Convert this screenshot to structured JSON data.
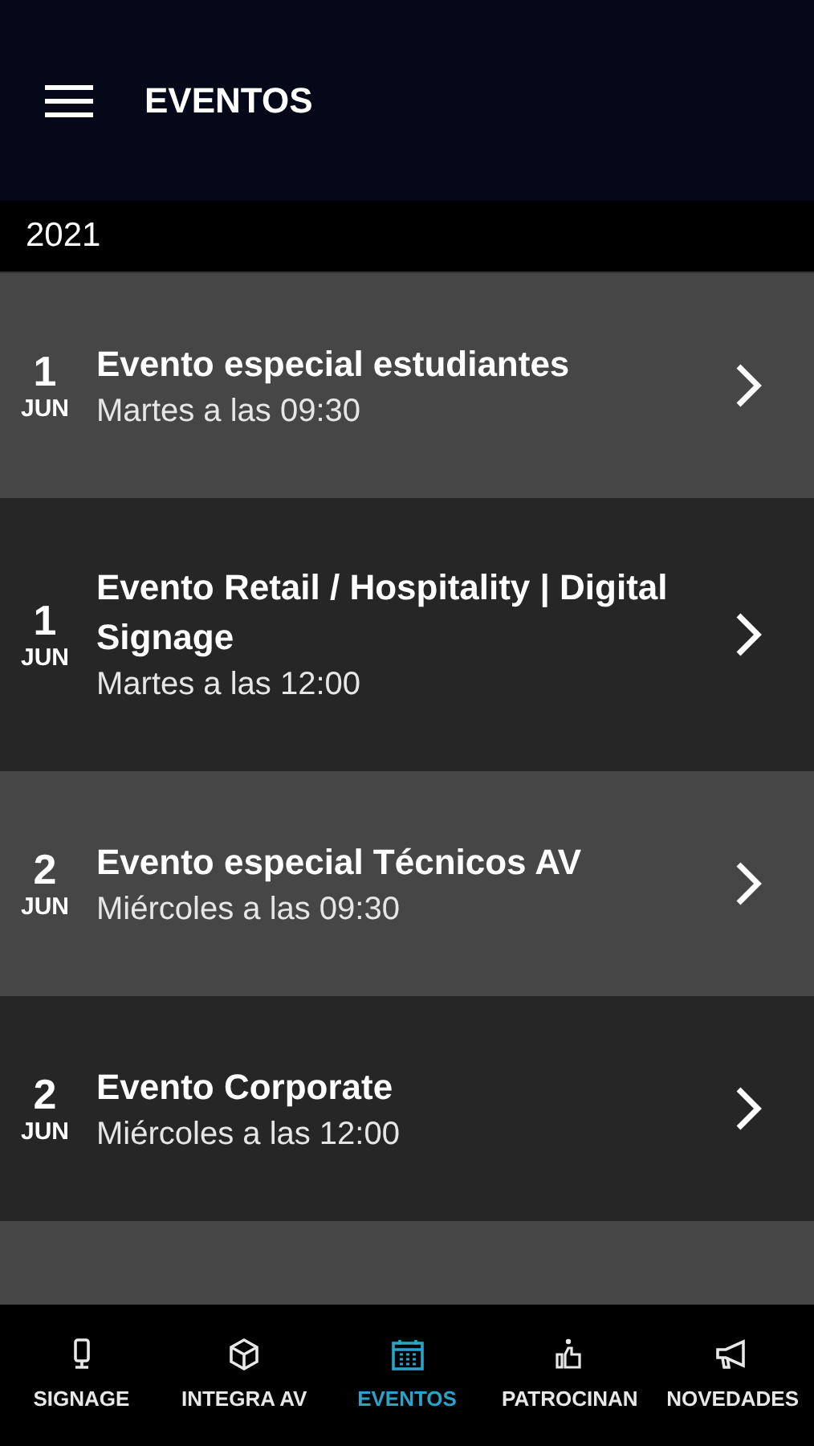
{
  "app_bar": {
    "title": "EVENTOS"
  },
  "year": "2021",
  "events": [
    {
      "day": "1",
      "month": "JUN",
      "title": "Evento especial estudiantes",
      "time": "Martes a las 09:30"
    },
    {
      "day": "1",
      "month": "JUN",
      "title": "Evento Retail / Hospitality | Digital Signage",
      "time": "Martes a las 12:00"
    },
    {
      "day": "2",
      "month": "JUN",
      "title": "Evento especial Técnicos AV",
      "time": "Miércoles a las 09:30"
    },
    {
      "day": "2",
      "month": "JUN",
      "title": "Evento Corporate",
      "time": "Miércoles a las 12:00"
    }
  ],
  "bottom_nav": [
    {
      "label": "SIGNAGE",
      "selected": false
    },
    {
      "label": "INTEGRA AV",
      "selected": false
    },
    {
      "label": "EVENTOS",
      "selected": true
    },
    {
      "label": "PATROCINAN",
      "selected": false
    },
    {
      "label": "NOVEDADES",
      "selected": false
    }
  ]
}
